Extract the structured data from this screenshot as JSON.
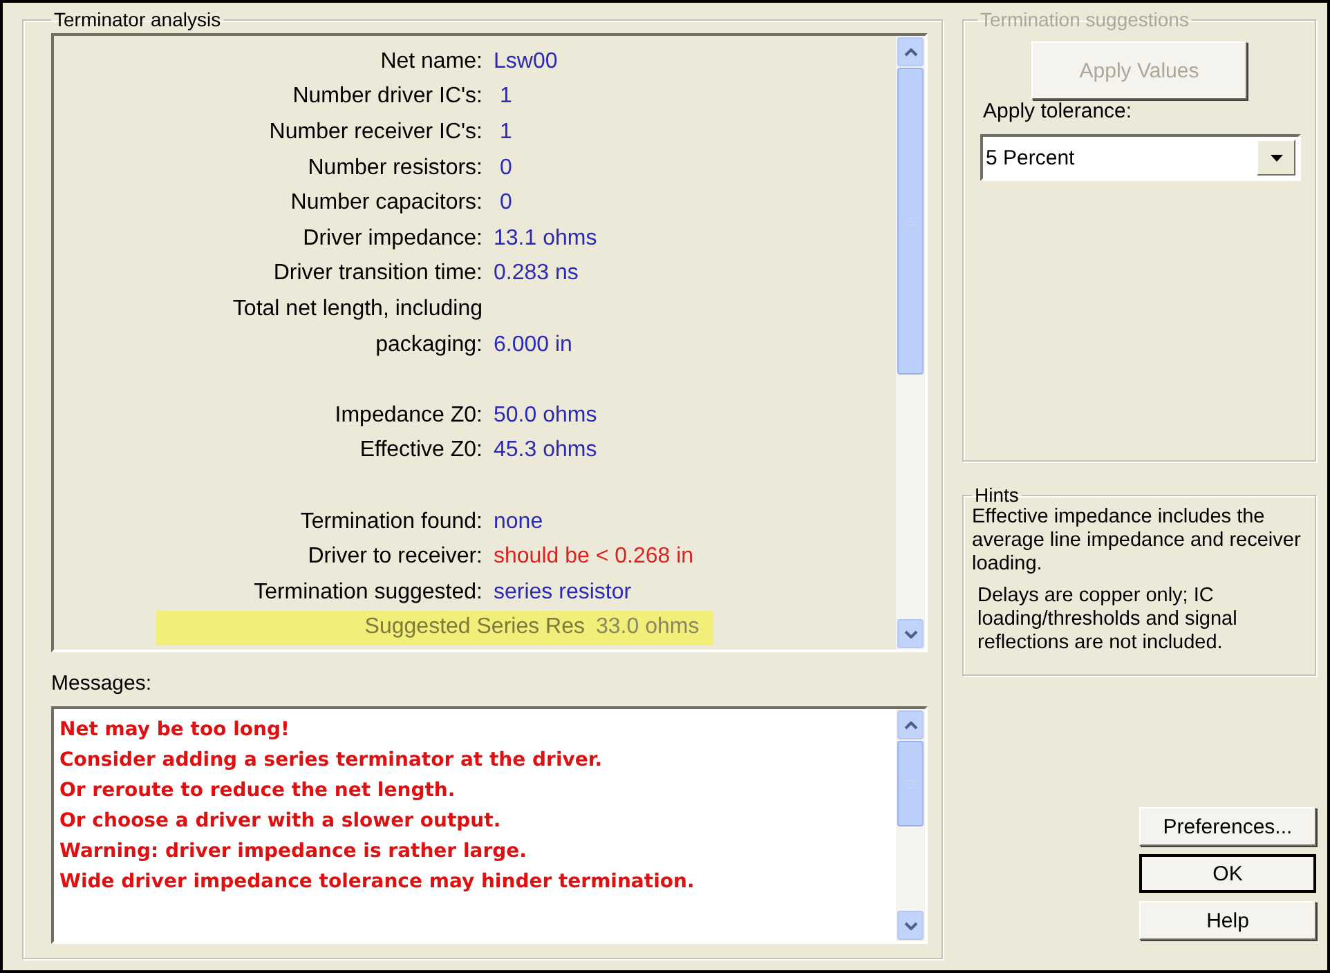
{
  "analysis": {
    "title": "Terminator analysis",
    "groups": [
      [
        {
          "label": "Net name:",
          "value": "Lsw00",
          "kind": "normal"
        },
        {
          "label": "Number driver IC's:",
          "value": " 1",
          "kind": "normal"
        },
        {
          "label": "Number receiver IC's:",
          "value": " 1",
          "kind": "normal"
        },
        {
          "label": "Number resistors:",
          "value": " 0",
          "kind": "normal"
        },
        {
          "label": "Number capacitors:",
          "value": " 0",
          "kind": "normal"
        },
        {
          "label": "Driver impedance:",
          "value": "13.1 ohms",
          "kind": "normal"
        },
        {
          "label": "Driver transition time:",
          "value": "0.283 ns",
          "kind": "normal"
        },
        {
          "label": "Total net length, including",
          "kind": "normal"
        },
        {
          "label": "packaging:",
          "value": "6.000 in",
          "kind": "normal"
        }
      ],
      [
        {
          "label": "Impedance Z0:",
          "value": "50.0 ohms",
          "kind": "normal"
        },
        {
          "label": "Effective Z0:",
          "value": "45.3 ohms",
          "kind": "normal"
        }
      ],
      [
        {
          "label": "Termination found:",
          "value": "none",
          "kind": "normal"
        },
        {
          "label": "Driver to receiver:",
          "value": "should be < 0.268 in",
          "kind": "alert"
        },
        {
          "label": "Termination suggested:",
          "value": "series resistor",
          "kind": "normal"
        },
        {
          "label": "Suggested Series Res",
          "value": "33.0 ohms",
          "kind": "highlight"
        }
      ]
    ],
    "messages_label": "Messages:",
    "messages": [
      "Net may be too long!",
      "Consider adding a series terminator at the driver.",
      "Or reroute to reduce the net length.",
      "Or choose a driver with a slower output.",
      "Warning: driver impedance is rather large.",
      "Wide driver impedance tolerance may hinder termination."
    ]
  },
  "suggestions": {
    "title": "Termination suggestions",
    "disabled": true,
    "apply_button": {
      "label": "Apply Values",
      "disabled": true
    },
    "tolerance_label": "Apply tolerance:",
    "tolerance_value": "5 Percent"
  },
  "hints": {
    "title": "Hints",
    "paragraphs": [
      "Effective impedance includes the average line impedance and receiver loading.",
      "Delays are copper only; IC loading/thresholds and signal reflections are not  included."
    ]
  },
  "buttons": [
    {
      "label": "Preferences...",
      "selected": false
    },
    {
      "label": "OK",
      "selected": true
    },
    {
      "label": "Help",
      "selected": false
    }
  ]
}
